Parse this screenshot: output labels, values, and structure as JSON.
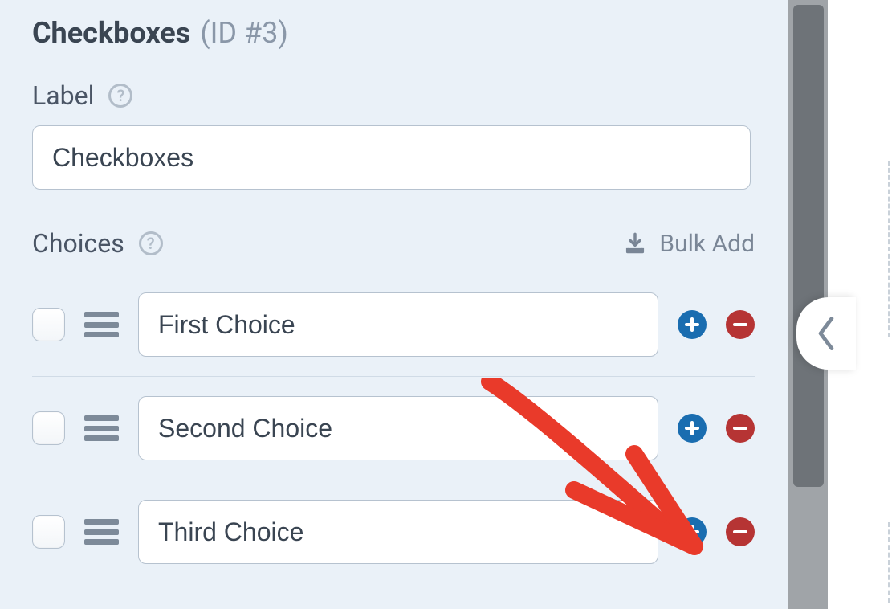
{
  "field": {
    "title": "Checkboxes",
    "id_label": "(ID #3)"
  },
  "labelSection": {
    "label": "Label",
    "value": "Checkboxes"
  },
  "choicesSection": {
    "label": "Choices",
    "bulkAddLabel": "Bulk Add"
  },
  "choices": [
    {
      "value": "First Choice"
    },
    {
      "value": "Second Choice"
    },
    {
      "value": "Third Choice"
    }
  ]
}
